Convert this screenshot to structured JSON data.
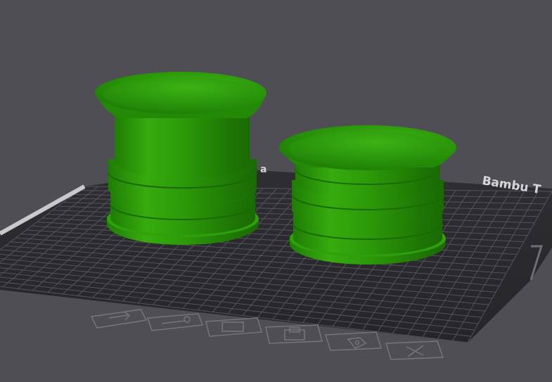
{
  "viewport": {
    "background": "#4f4e54",
    "plate": {
      "brand_text": "Bambu T",
      "side_text": "a",
      "surface_color": "#2b2a2e",
      "grid_color": "#5f5e66",
      "icon_color": "#76757c",
      "icons": [
        "arrow-right-icon",
        "wrench-icon",
        "monitor-icon",
        "printer-icon",
        "tag-icon",
        "close-x-icon"
      ]
    },
    "objects": [
      {
        "name": "bell-spacer-left",
        "color": "#2fa10c"
      },
      {
        "name": "bell-spacer-right",
        "color": "#2fa10c"
      }
    ]
  }
}
